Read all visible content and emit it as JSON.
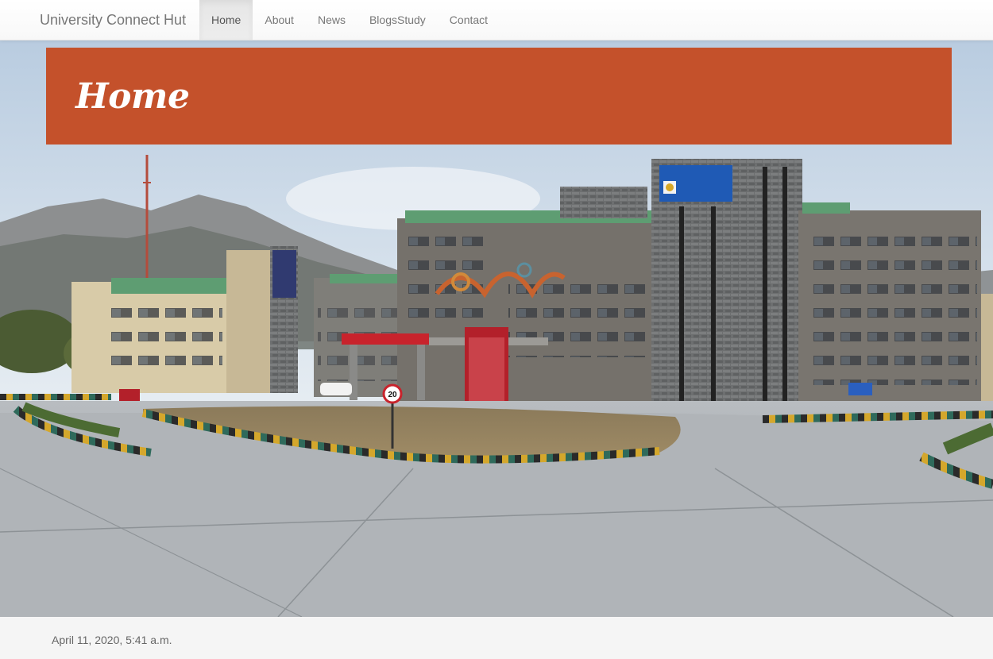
{
  "navbar": {
    "brand": "University Connect Hut",
    "items": [
      {
        "label": "Home",
        "active": true
      },
      {
        "label": "About",
        "active": false
      },
      {
        "label": "News",
        "active": false
      },
      {
        "label": "BlogsStudy",
        "active": false
      },
      {
        "label": "Contact",
        "active": false
      }
    ]
  },
  "header": {
    "title": "Home",
    "accent_color": "#c4512b"
  },
  "hero": {
    "sign_speed": "20"
  },
  "post": {
    "timestamp": "April 11, 2020, 5:41 a.m."
  }
}
